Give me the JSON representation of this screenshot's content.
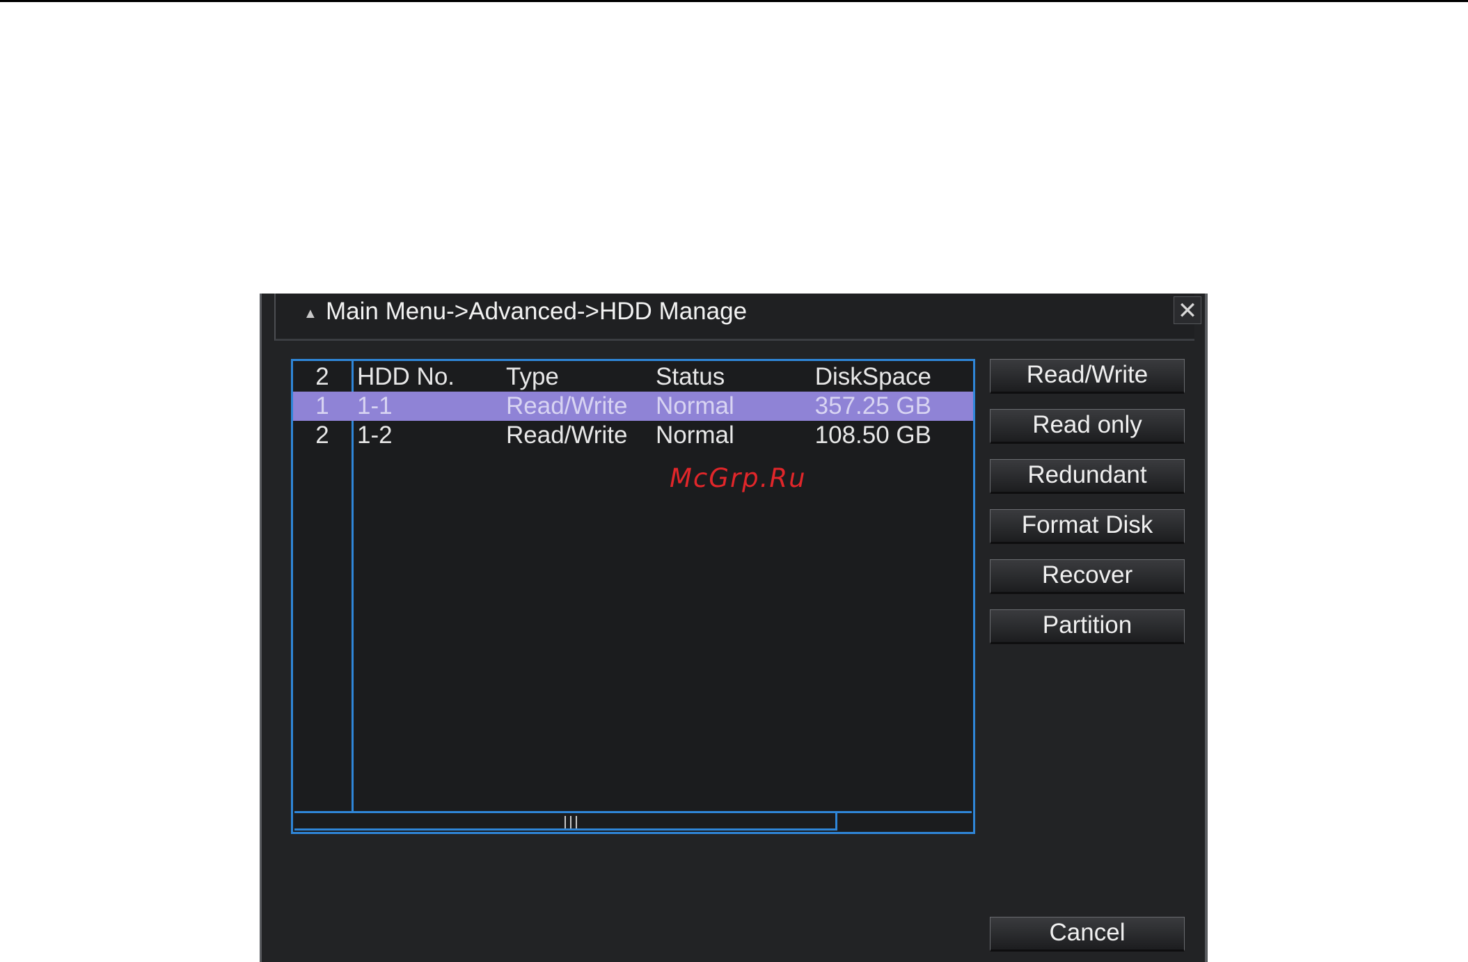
{
  "window": {
    "breadcrumb": "Main Menu->Advanced->HDD Manage",
    "close_symbol": "✕"
  },
  "table": {
    "header": {
      "index": "2",
      "hdd_no": "HDD No.",
      "type": "Type",
      "status": "Status",
      "disk_space": "DiskSpace"
    },
    "rows": [
      {
        "index": "1",
        "hdd_no": "1-1",
        "type": "Read/Write",
        "status": "Normal",
        "disk_space": "357.25 GB",
        "selected": true
      },
      {
        "index": "2",
        "hdd_no": "1-2",
        "type": "Read/Write",
        "status": "Normal",
        "disk_space": "108.50 GB",
        "selected": false
      }
    ]
  },
  "actions": {
    "read_write": "Read/Write",
    "read_only": "Read only",
    "redundant": "Redundant",
    "format_disk": "Format Disk",
    "recover": "Recover",
    "partition": "Partition",
    "cancel": "Cancel"
  },
  "watermark": "McGrp.Ru",
  "colors": {
    "panel_border": "#2f86d8",
    "selection": "#8f83d6",
    "window_bg": "#222325",
    "watermark": "#e1262a"
  },
  "icons": {
    "title_icon": "hdd-icon",
    "close_icon": "close-icon",
    "scroll_grip": "grip-icon"
  }
}
